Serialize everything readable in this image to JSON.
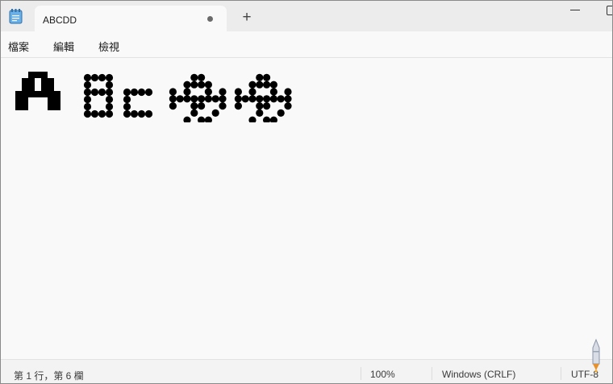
{
  "tab": {
    "title": "ABCDD"
  },
  "new_tab_label": "+",
  "menu": [
    "檔案",
    "編輯",
    "檢視"
  ],
  "status": {
    "position": "第 1 行，第 6 欄",
    "zoom": "100%",
    "line_ending": "Windows (CRLF)",
    "encoding": "UTF-8"
  },
  "icons": {
    "app": "notepad-icon",
    "new_tab": "plus-icon",
    "minimize": "minimize-icon",
    "maximize": "maximize-icon",
    "pen": "pen-icon",
    "unsaved": "unsaved-dot-icon"
  },
  "editor_content": {
    "glyphs": [
      {
        "char": "A",
        "style": "block"
      },
      {
        "char": "B",
        "style": "dots"
      },
      {
        "char": "C",
        "style": "dots"
      },
      {
        "char": "D",
        "style": "dots"
      },
      {
        "char": "D",
        "style": "dots"
      }
    ]
  },
  "colors": {
    "text": "#000000",
    "background": "#f9f9f9",
    "titlebar": "#ececec"
  }
}
